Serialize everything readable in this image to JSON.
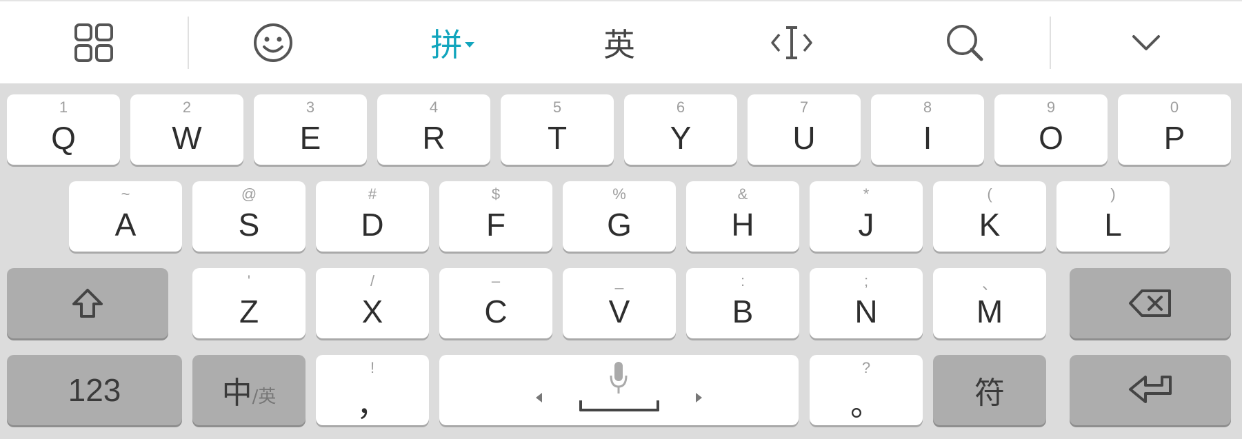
{
  "toolbar": {
    "menu_icon": "grid-icon",
    "emoji_icon": "smiley-icon",
    "pinyin_label": "拼",
    "english_label": "英",
    "cursor_icon": "text-cursor-icon",
    "search_icon": "search-icon",
    "collapse_icon": "chevron-down-icon",
    "accent_color": "#12a5bd"
  },
  "keys": {
    "row1": [
      {
        "main": "Q",
        "sub": "1"
      },
      {
        "main": "W",
        "sub": "2"
      },
      {
        "main": "E",
        "sub": "3"
      },
      {
        "main": "R",
        "sub": "4"
      },
      {
        "main": "T",
        "sub": "5"
      },
      {
        "main": "Y",
        "sub": "6"
      },
      {
        "main": "U",
        "sub": "7"
      },
      {
        "main": "I",
        "sub": "8"
      },
      {
        "main": "O",
        "sub": "9"
      },
      {
        "main": "P",
        "sub": "0"
      }
    ],
    "row2": [
      {
        "main": "A",
        "sub": "~"
      },
      {
        "main": "S",
        "sub": "@"
      },
      {
        "main": "D",
        "sub": "#"
      },
      {
        "main": "F",
        "sub": "$"
      },
      {
        "main": "G",
        "sub": "%"
      },
      {
        "main": "H",
        "sub": "&"
      },
      {
        "main": "J",
        "sub": "*"
      },
      {
        "main": "K",
        "sub": "("
      },
      {
        "main": "L",
        "sub": ")"
      }
    ],
    "row3": [
      {
        "main": "Z",
        "sub": "'"
      },
      {
        "main": "X",
        "sub": "/"
      },
      {
        "main": "C",
        "sub": "–"
      },
      {
        "main": "V",
        "sub": "_"
      },
      {
        "main": "B",
        "sub": ":"
      },
      {
        "main": "N",
        "sub": ";"
      },
      {
        "main": "M",
        "sub": "、"
      }
    ],
    "shift_icon": "shift-arrow-icon",
    "backspace_icon": "backspace-icon",
    "numbers_label": "123",
    "lang_main": "中",
    "lang_sub": "/英",
    "comma_main": "，",
    "comma_sub": "!",
    "space_mic_icon": "microphone-icon",
    "period_main": "。",
    "period_sub": "?",
    "symbols_label": "符",
    "enter_icon": "enter-return-icon",
    "key_background": "#ffffff",
    "function_key_background": "#adadad",
    "keyboard_background": "#dcdcdc"
  }
}
